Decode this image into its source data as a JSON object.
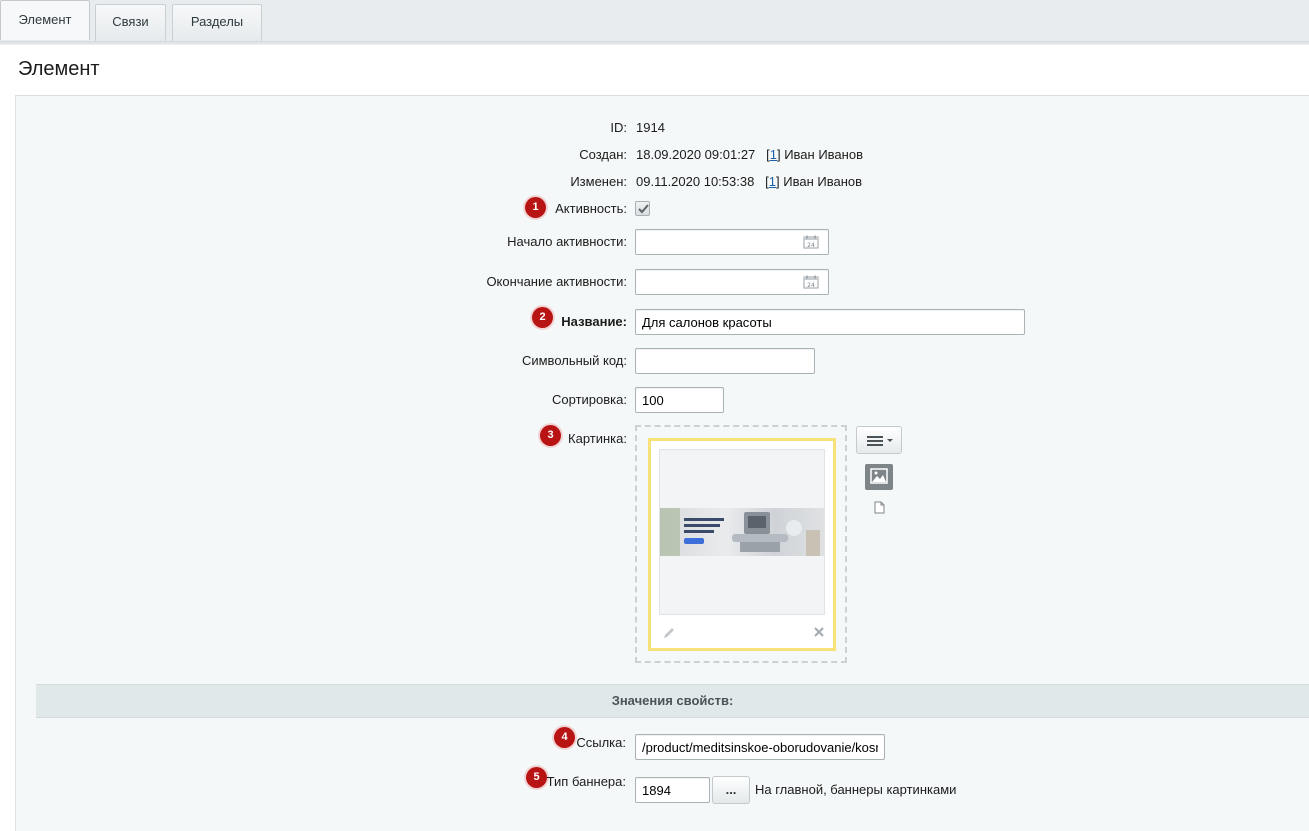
{
  "tabs": [
    {
      "label": "Элемент",
      "active": true
    },
    {
      "label": "Связи",
      "active": false
    },
    {
      "label": "Разделы",
      "active": false
    }
  ],
  "page_title": "Элемент",
  "fields": {
    "id": {
      "label": "ID:",
      "value": "1914"
    },
    "created": {
      "label": "Создан:",
      "date": "18.09.2020 09:01:27",
      "user_id": "1",
      "user_name": "Иван Иванов"
    },
    "modified": {
      "label": "Изменен:",
      "date": "09.11.2020 10:53:38",
      "user_id": "1",
      "user_name": "Иван Иванов"
    },
    "active": {
      "label": "Активность:",
      "checked": true
    },
    "active_from": {
      "label": "Начало активности:",
      "value": ""
    },
    "active_to": {
      "label": "Окончание активности:",
      "value": ""
    },
    "name": {
      "label": "Название:",
      "value": "Для салонов красоты"
    },
    "code": {
      "label": "Символьный код:",
      "value": ""
    },
    "sort": {
      "label": "Сортировка:",
      "value": "100"
    },
    "picture": {
      "label": "Картинка:"
    }
  },
  "properties_header": "Значения свойств:",
  "properties": {
    "link": {
      "label": "Ссылка:",
      "value": "/product/meditsinskoe-oborudovanie/kosr"
    },
    "banner_type": {
      "label": "Тип баннера:",
      "value": "1894",
      "button": "...",
      "description": "На главной, баннеры картинками"
    }
  },
  "badges": [
    "1",
    "2",
    "3",
    "4",
    "5"
  ],
  "icons": {
    "calendar": "calendar-icon",
    "checkbox": "checkmark-icon",
    "menu": "hamburger-menu-icon",
    "image": "image-icon",
    "file": "file-icon",
    "edit": "pencil-icon",
    "delete": "close-icon"
  },
  "colors": {
    "badge": "#b81414",
    "link": "#1c5fa8",
    "picture_frame": "#f7e27a",
    "section_header_bg": "#e0e8ea"
  }
}
